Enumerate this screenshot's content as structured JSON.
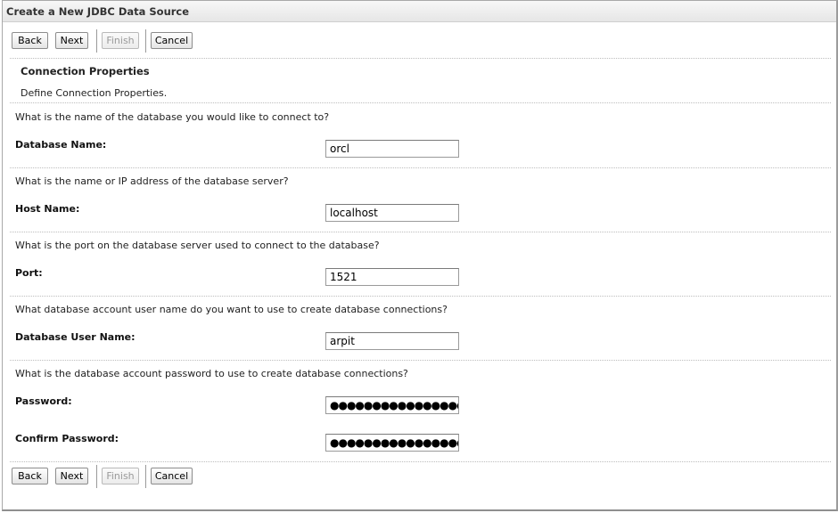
{
  "window": {
    "title": "Create a New JDBC Data Source"
  },
  "toolbar": {
    "back": "Back",
    "next": "Next",
    "finish": "Finish",
    "cancel": "Cancel"
  },
  "section": {
    "title": "Connection Properties",
    "description": "Define Connection Properties."
  },
  "fields": {
    "database_name": {
      "question": "What is the name of the database you would like to connect to?",
      "label": "Database Name:",
      "value": "orcl"
    },
    "host_name": {
      "question": "What is the name or IP address of the database server?",
      "label": "Host Name:",
      "value": "localhost"
    },
    "port": {
      "question": "What is the port on the database server used to connect to the database?",
      "label": "Port:",
      "value": "1521"
    },
    "db_user": {
      "question": "What database account user name do you want to use to create database connections?",
      "label": "Database User Name:",
      "value": "arpit"
    },
    "password": {
      "question": "What is the database account password to use to create database connections?",
      "label": "Password:",
      "value": "●●●●●●●●●●●●●●●●●●●●"
    },
    "confirm_password": {
      "label": "Confirm Password:",
      "value": "●●●●●●●●●●●●●●●●●●●●"
    }
  }
}
